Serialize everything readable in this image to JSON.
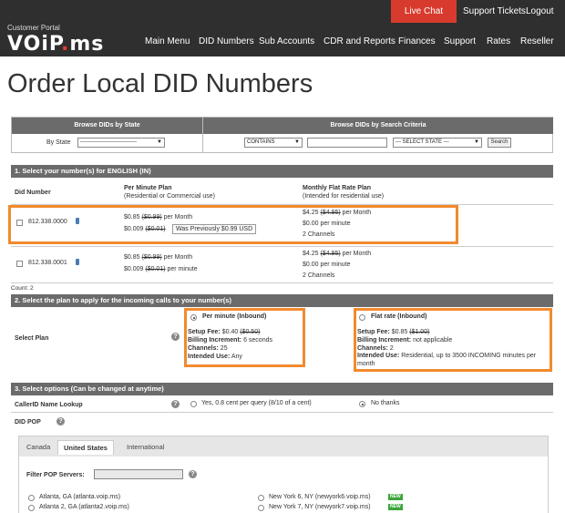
{
  "header": {
    "brand_small": "Customer Portal",
    "brand_logo_a": "VOiP",
    "brand_logo_dot": ".",
    "brand_logo_b": "ms",
    "live_chat": "Live Chat",
    "support_tickets": "Support Tickets",
    "logout": "Logout",
    "nav": [
      "Main Menu",
      "DID Numbers",
      "Sub Accounts",
      "CDR and Reports",
      "Finances",
      "Support",
      "Rates",
      "Reseller"
    ]
  },
  "page_title": "Order Local DID Numbers",
  "browse": {
    "by_state_header": "Browse DIDs by State",
    "by_criteria_header": "Browse DIDs by Search Criteria",
    "by_state_label": "By State",
    "state_select_value": "-------------------------------",
    "contains_select": "CONTAINS",
    "select_state": "--- SELECT STATE ---",
    "search_button": "Search"
  },
  "section1": {
    "title": "1. Select your number(s) for ENGLISH (IN)",
    "col_did": "Did Number",
    "col_perminute": "Per Minute Plan",
    "col_perminute_sub": "(Residential or Commercial use)",
    "col_flat": "Monthly Flat Rate Plan",
    "col_flat_sub": "(Intended for residential use)",
    "rows": [
      {
        "number": "812.338.0000",
        "pm_line1_price": "$0.85",
        "pm_line1_old": "($0.99)",
        "pm_line1_unit": "per Month",
        "pm_line2_price": "$0.009",
        "pm_line2_old": "($0.01)",
        "tooltip": "Was Previously $0.99 USD",
        "flat_line1_price": "$4.25",
        "flat_line1_old": "($4.95)",
        "flat_line1_unit": "per Month",
        "flat_line2": "$0.00 per minute",
        "flat_line3": "2 Channels"
      },
      {
        "number": "812.338.0001",
        "pm_line1_price": "$0.85",
        "pm_line1_old": "($0.99)",
        "pm_line1_unit": "per Month",
        "pm_line2_price": "$0.009",
        "pm_line2_old": "($0.01)",
        "pm_line2_unit": "per minute",
        "flat_line1_price": "$4.25",
        "flat_line1_old": "($4.95)",
        "flat_line1_unit": "per Month",
        "flat_line2": "$0.00 per minute",
        "flat_line3": "2 Channels"
      }
    ],
    "count": "Count: 2"
  },
  "section2": {
    "title": "2. Select the plan to apply for the incoming calls to your number(s)",
    "label": "Select Plan",
    "per_minute": {
      "title": "Per minute (Inbound)",
      "setup_label": "Setup Fee:",
      "setup_price": "$0.40",
      "setup_old": "($0.50)",
      "billing_label": "Billing Increment:",
      "billing_value": "6 seconds",
      "channels_label": "Channels:",
      "channels_value": "25",
      "use_label": "Intended Use:",
      "use_value": "Any"
    },
    "flat_rate": {
      "title": "Flat rate (Inbound)",
      "setup_label": "Setup Fee:",
      "setup_price": "$0.85",
      "setup_old": "($1.00)",
      "billing_label": "Billing Increment:",
      "billing_value": "not applicable",
      "channels_label": "Channels:",
      "channels_value": "2",
      "use_label": "Intended Use:",
      "use_value": "Residential, up to 3500 INCOMING minutes per month"
    }
  },
  "section3": {
    "title": "3. Select options (Can be changed at anytime)",
    "callerid_label": "CallerID Name Lookup",
    "callerid_yes": "Yes, 0.8 cent per query (8/10 of a cent)",
    "callerid_no": "No thanks",
    "did_pop_label": "DID POP",
    "tabs": [
      "Canada",
      "United States",
      "International"
    ],
    "filter_label": "Filter POP Servers:",
    "servers_left": [
      "Atlanta, GA (atlanta.voip.ms)",
      "Atlanta 2, GA (atlanta2.voip.ms)"
    ],
    "servers_right": [
      "New York 6, NY (newyork6.voip.ms)",
      "New York 7, NY (newyork7.voip.ms)"
    ],
    "new_badge": "NEW"
  },
  "colors": {
    "topbar": "#2f2f2f",
    "live_chat": "#d83b2e",
    "section_bar": "#6b6b6b",
    "highlight": "#f28a2e",
    "new_badge": "#3aa63a"
  }
}
